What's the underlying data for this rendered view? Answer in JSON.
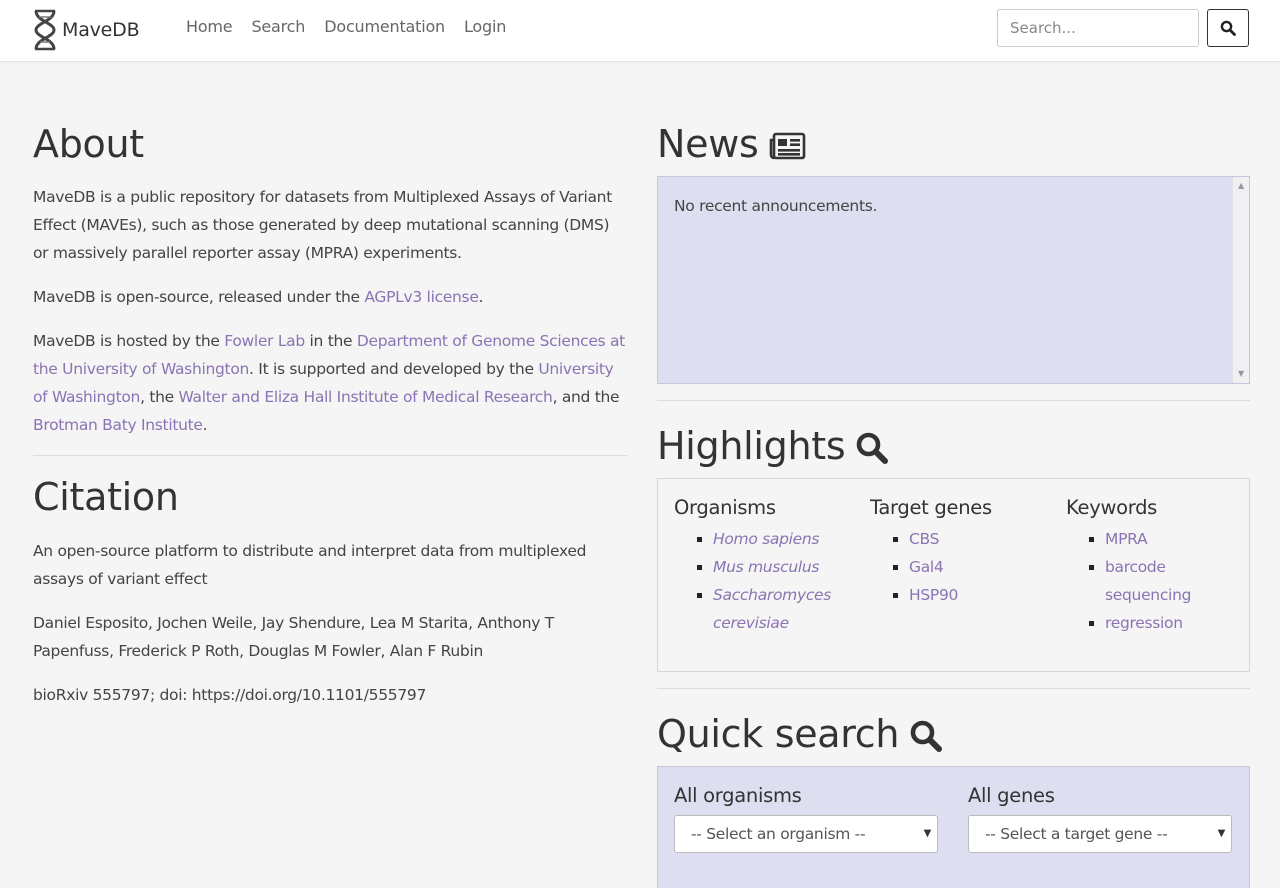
{
  "navbar": {
    "brand": "MaveDB",
    "links": [
      "Home",
      "Search",
      "Documentation",
      "Login"
    ],
    "search_placeholder": "Search..."
  },
  "about": {
    "title": "About",
    "p1": "MaveDB is a public repository for datasets from Multiplexed Assays of Variant Effect (MAVEs), such as those generated by deep mutational scanning (DMS) or massively parallel reporter assay (MPRA) experiments.",
    "p2_before": "MaveDB is open-source, released under the ",
    "p2_link": "AGPLv3 license",
    "p2_after": ".",
    "p3_a": "MaveDB is hosted by the ",
    "p3_link_fowler": "Fowler Lab",
    "p3_b": " in the ",
    "p3_link_dept": "Department of Genome Sciences at the University of Washington",
    "p3_c": ". It is supported and developed by the ",
    "p3_link_uw": "University of Washington",
    "p3_d": ", the ",
    "p3_link_wehi": "Walter and Eliza Hall Institute of Medical Research",
    "p3_e": ", and the ",
    "p3_link_bbi": "Brotman Baty Institute",
    "p3_f": "."
  },
  "citation": {
    "title": "Citation",
    "paper_title": "An open-source platform to distribute and interpret data from multiplexed assays of variant effect",
    "authors": "Daniel Esposito, Jochen Weile, Jay Shendure, Lea M Starita, Anthony T Papenfuss, Frederick P Roth, Douglas M Fowler, Alan F Rubin",
    "reference": "bioRxiv 555797; doi: https://doi.org/10.1101/555797"
  },
  "news": {
    "title": "News",
    "message": "No recent announcements."
  },
  "highlights": {
    "title": "Highlights",
    "organisms_title": "Organisms",
    "organisms": [
      "Homo sapiens",
      "Mus musculus",
      "Saccharomyces cerevisiae"
    ],
    "genes_title": "Target genes",
    "genes": [
      "CBS",
      "Gal4",
      "HSP90"
    ],
    "keywords_title": "Keywords",
    "keywords": [
      "MPRA",
      "barcode sequencing",
      "regression"
    ]
  },
  "quick_search": {
    "title": "Quick search",
    "organisms_label": "All organisms",
    "organisms_select": "-- Select an organism --",
    "genes_label": "All genes",
    "genes_select": "-- Select a target gene --"
  },
  "colors": {
    "link": "#8a74b3",
    "panel": "#dddff0",
    "background": "#f5f5f5"
  }
}
